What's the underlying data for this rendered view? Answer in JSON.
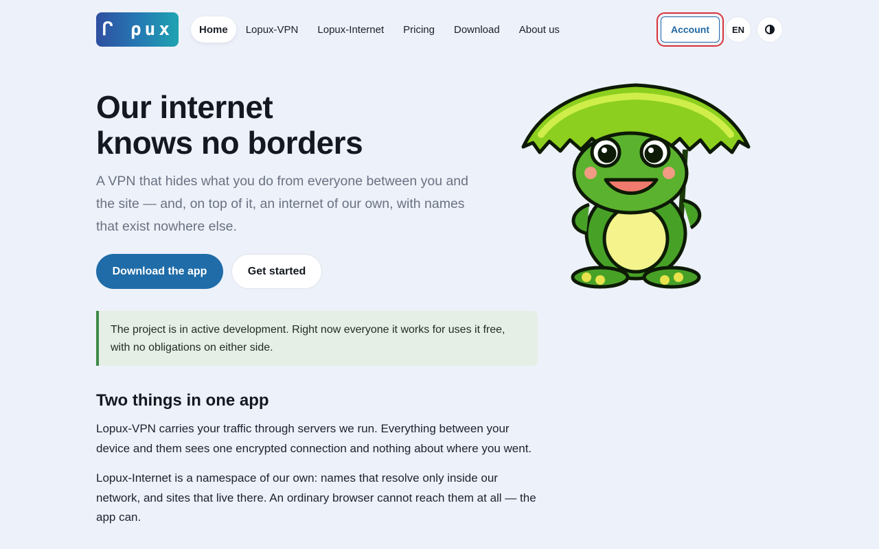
{
  "header": {
    "logo_text": "ᒋ ρux",
    "nav": [
      {
        "label": "Home",
        "active": true
      },
      {
        "label": "Lopux-VPN",
        "active": false
      },
      {
        "label": "Lopux-Internet",
        "active": false
      },
      {
        "label": "Pricing",
        "active": false
      },
      {
        "label": "Download",
        "active": false
      },
      {
        "label": "About us",
        "active": false
      }
    ],
    "account_label": "Account",
    "language_label": "EN",
    "theme_icon": "contrast-icon"
  },
  "hero": {
    "title_line_1": "Our internet",
    "title_line_2": "knows no borders",
    "subtitle": "A VPN that hides what you do from everyone between you and the site — and, on top of it, an internet of our own, with names that exist nowhere else.",
    "primary_button": "Download the app",
    "secondary_button": "Get started",
    "mascot": "frog-with-leaf-umbrella"
  },
  "notice": {
    "text": "The project is in active development. Right now everyone it works for uses it free, with no obligations on either side."
  },
  "section": {
    "title": "Two things in one app",
    "paragraph_1": "Lopux-VPN carries your traffic through servers we run. Everything between your device and them sees one encrypted connection and nothing about where you went.",
    "paragraph_2": "Lopux-Internet is a namespace of our own: names that resolve only inside our network, and sites that live there. An ordinary browser cannot reach them at all — the app can."
  },
  "colors": {
    "background": "#edf1f9",
    "accent": "#1f6ca8",
    "notice_bg": "#e6efe6",
    "notice_border": "#3f8a46",
    "highlight": "#d9323a"
  }
}
